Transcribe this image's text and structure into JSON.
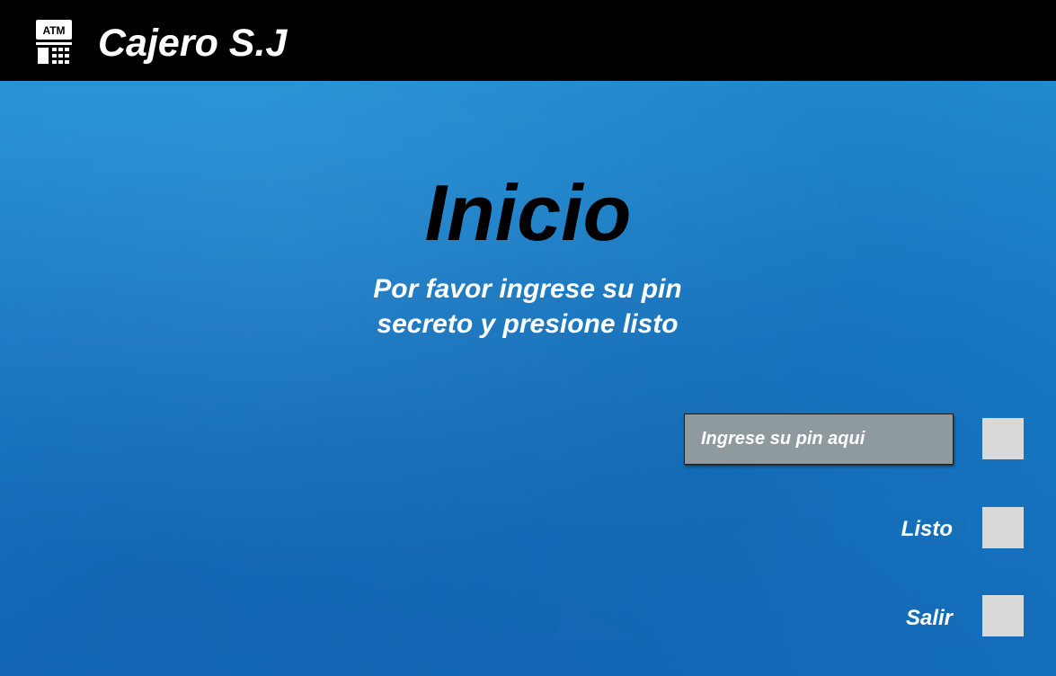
{
  "header": {
    "logo_text": "ATM",
    "logo_icon": "atm-machine-icon",
    "title": "Cajero S.J",
    "background": "#000000"
  },
  "main": {
    "heading": "Inicio",
    "instructions": "Por favor ingrese su pin secreto y presione listo",
    "pin_input": {
      "value": "",
      "placeholder": "Ingrese su pin aqui"
    },
    "side_keys": [
      {
        "label": ""
      },
      {
        "label": "Listo"
      },
      {
        "label": "Salir"
      }
    ]
  },
  "colors": {
    "background_top": "#2597d8",
    "background_bottom": "#146fbd",
    "input_background": "#8f9a9e",
    "key_color": "#d9d9d9",
    "text_light": "#ffffff",
    "text_dark": "#000000"
  }
}
